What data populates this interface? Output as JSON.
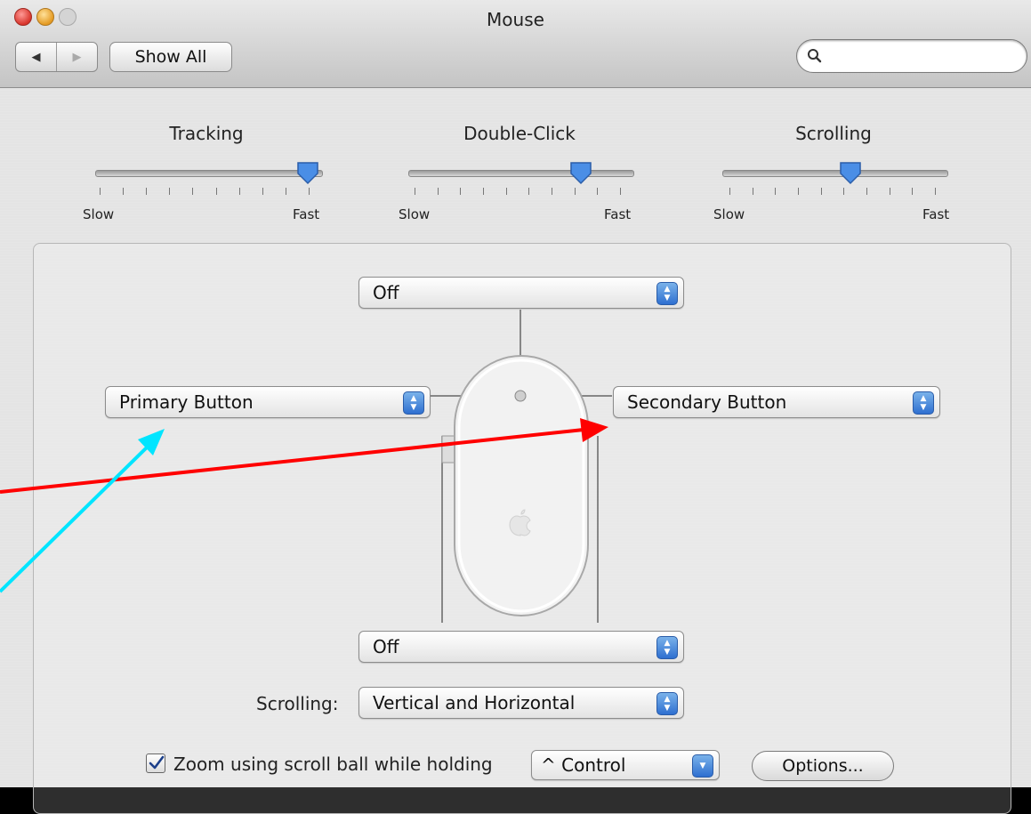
{
  "window": {
    "title": "Mouse",
    "show_all_label": "Show All",
    "search_placeholder": ""
  },
  "sliders": [
    {
      "label": "Tracking",
      "min_label": "Slow",
      "max_label": "Fast",
      "level": 0.94
    },
    {
      "label": "Double-Click",
      "min_label": "Slow",
      "max_label": "Fast",
      "level": 0.77
    },
    {
      "label": "Scrolling",
      "min_label": "Slow",
      "max_label": "Fast",
      "level": 0.57
    }
  ],
  "mouse_buttons": {
    "top_button": "Off",
    "left_button": "Primary Button",
    "right_button": "Secondary Button",
    "bottom_button": "Off"
  },
  "scrolling": {
    "label": "Scrolling:",
    "value": "Vertical and Horizontal"
  },
  "zoom": {
    "checked": true,
    "label": "Zoom using scroll ball while holding",
    "modifier": "^ Control",
    "options_label": "Options..."
  },
  "colors": {
    "annotation_red": "#ff0000",
    "annotation_cyan": "#00e5ff",
    "accent_blue": "#3c7fdd"
  }
}
